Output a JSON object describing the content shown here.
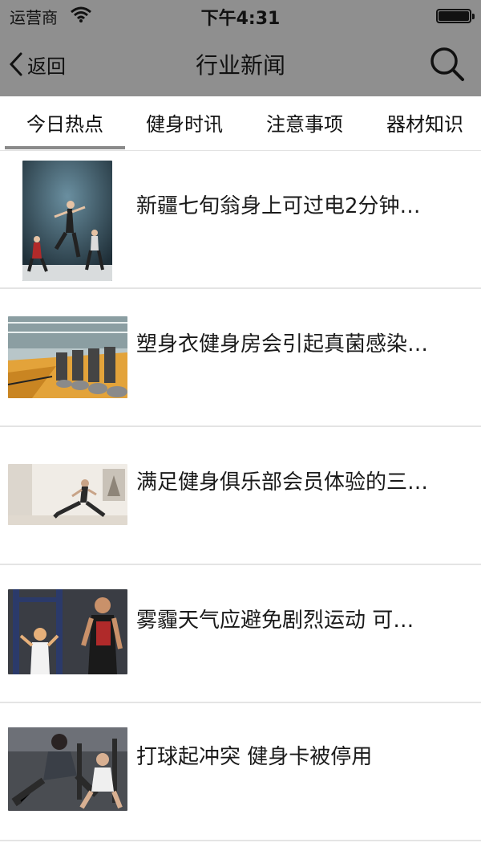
{
  "status_bar": {
    "carrier": "运营商",
    "time": "下午4:31"
  },
  "nav": {
    "back_label": "返回",
    "title": "行业新闻"
  },
  "tabs": [
    {
      "label": "今日热点",
      "active": true
    },
    {
      "label": "健身时讯",
      "active": false
    },
    {
      "label": "注意事项",
      "active": false
    },
    {
      "label": "器材知识",
      "active": false
    }
  ],
  "articles": [
    {
      "title": "新疆七旬翁身上可过电2分钟…",
      "thumbnail": "dancers-photo"
    },
    {
      "title": "塑身衣健身房会引起真菌感染…",
      "thumbnail": "gym-treadmills-photo"
    },
    {
      "title": "满足健身俱乐部会员体验的三…",
      "thumbnail": "yoga-room-photo"
    },
    {
      "title": "雾霾天气应避免剧烈运动 可…",
      "thumbnail": "trainer-weights-photo"
    },
    {
      "title": "打球起冲突 健身卡被停用",
      "thumbnail": "couple-workout-photo"
    }
  ],
  "colors": {
    "nav_bar": "#8f8f8f",
    "tab_indicator": "#8a8a8a",
    "divider": "#e4e4e4"
  }
}
